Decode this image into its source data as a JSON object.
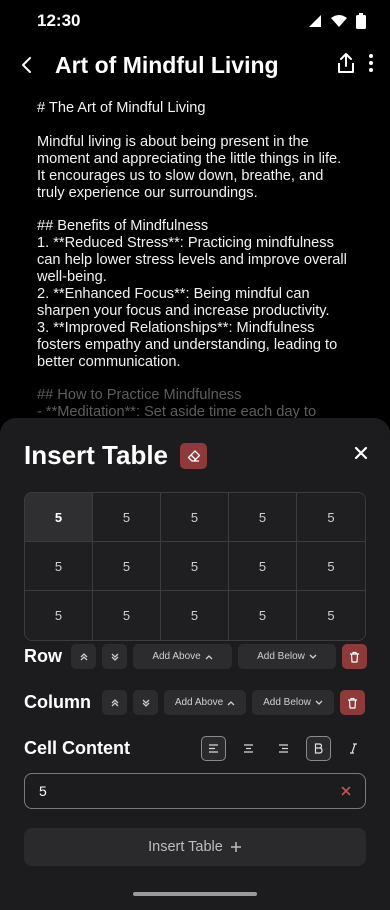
{
  "status": {
    "time": "12:30"
  },
  "header": {
    "title": "Art of Mindful Living"
  },
  "document": {
    "lines": [
      "# The Art of Mindful Living",
      "",
      "Mindful living is about being present in the",
      "moment and appreciating the little things in life.",
      "It encourages us to slow down, breathe, and",
      "truly experience our surroundings.",
      "",
      "## Benefits of Mindfulness",
      "1. **Reduced Stress**: Practicing mindfulness",
      "can help lower stress levels and improve overall",
      "well-being.",
      "2. **Enhanced Focus**: Being mindful can",
      "sharpen your focus and increase productivity.",
      "3. **Improved Relationships**: Mindfulness",
      "fosters empathy and understanding, leading to",
      "better communication.",
      ""
    ],
    "faded_lines": [
      "## How to Practice Mindfulness",
      "- **Meditation**: Set aside time each day to"
    ]
  },
  "sheet": {
    "title": "Insert Table",
    "table": {
      "rows": [
        [
          "5",
          "5",
          "5",
          "5",
          "5"
        ],
        [
          "5",
          "5",
          "5",
          "5",
          "5"
        ],
        [
          "5",
          "5",
          "5",
          "5",
          "5"
        ]
      ],
      "selected": {
        "row": 0,
        "col": 0
      }
    },
    "row": {
      "label": "Row",
      "add_above": "Add Above",
      "add_below": "Add Below"
    },
    "column": {
      "label": "Column",
      "add_above": "Add Above",
      "add_below": "Add Below"
    },
    "cell": {
      "label": "Cell Content",
      "value": "5"
    },
    "insert_label": "Insert Table"
  },
  "colors": {
    "background": "#000000",
    "sheet": "#1c1c1e",
    "danger": "#8e3a3a",
    "chip": "#2c2c2e"
  }
}
